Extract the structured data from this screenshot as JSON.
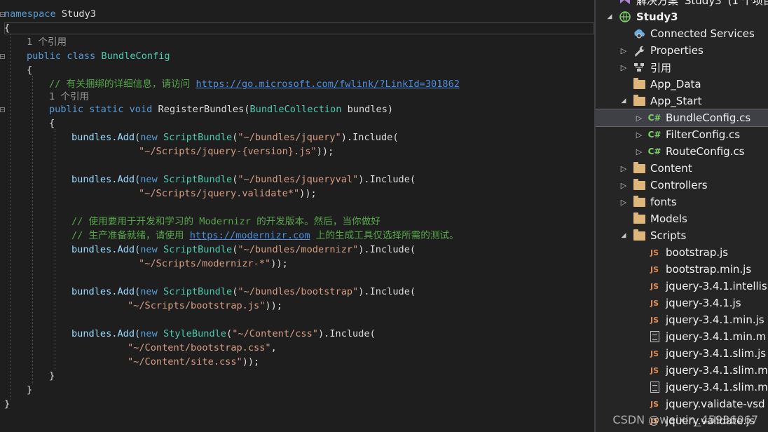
{
  "editor": {
    "lines": [
      {
        "kind": "ns",
        "kw": "namespace",
        "name": " Study3"
      },
      {
        "kind": "plain",
        "text": "{"
      },
      {
        "kind": "lens",
        "text": "1 个引用"
      },
      {
        "kind": "class",
        "kw1": "public",
        "kw2": "class",
        "name": "BundleConfig"
      },
      {
        "kind": "plain",
        "text": "{"
      },
      {
        "kind": "comment_link",
        "comment": "// 有关捆绑的详细信息，请访问 ",
        "link": "https://go.microsoft.com/fwlink/?LinkId=301862"
      },
      {
        "kind": "lens",
        "text": "1 个引用"
      },
      {
        "kind": "method",
        "kw1": "public",
        "kw2": "static",
        "kw3": "void",
        "name": "RegisterBundles",
        "ptype": "BundleCollection",
        "pname": "bundles"
      },
      {
        "kind": "plain",
        "text": "{"
      },
      {
        "kind": "add",
        "pre": "bundles.Add(",
        "kw": "new",
        "type": "ScriptBundle",
        "path": "\"~/bundles/jquery\"",
        "post": ").Include("
      },
      {
        "kind": "str_end",
        "str": "\"~/Scripts/jquery-{version}.js\"",
        "post": "));"
      },
      {
        "kind": "blank"
      },
      {
        "kind": "add",
        "pre": "bundles.Add(",
        "kw": "new",
        "type": "ScriptBundle",
        "path": "\"~/bundles/jqueryval\"",
        "post": ").Include("
      },
      {
        "kind": "str_end",
        "str": "\"~/Scripts/jquery.validate*\"",
        "post": "));"
      },
      {
        "kind": "blank"
      },
      {
        "kind": "comment",
        "text": "// 使用要用于开发和学习的 Modernizr 的开发版本。然后，当你做好"
      },
      {
        "kind": "comment_link2",
        "pre": "// 生产准备就绪，请使用 ",
        "link": "https://modernizr.com",
        "post": " 上的生成工具仅选择所需的测试。"
      },
      {
        "kind": "add",
        "pre": "bundles.Add(",
        "kw": "new",
        "type": "ScriptBundle",
        "path": "\"~/bundles/modernizr\"",
        "post": ").Include("
      },
      {
        "kind": "str_end",
        "str": "\"~/Scripts/modernizr-*\"",
        "post": "));"
      },
      {
        "kind": "blank"
      },
      {
        "kind": "add",
        "pre": "bundles.Add(",
        "kw": "new",
        "type": "ScriptBundle",
        "path": "\"~/bundles/bootstrap\"",
        "post": ").Include("
      },
      {
        "kind": "str_end",
        "str": "\"~/Scripts/bootstrap.js\"",
        "post": "));"
      },
      {
        "kind": "blank"
      },
      {
        "kind": "add",
        "pre": "bundles.Add(",
        "kw": "new",
        "type": "StyleBundle",
        "path": "\"~/Content/css\"",
        "post": ").Include("
      },
      {
        "kind": "str_end",
        "str": "\"~/Content/bootstrap.css\"",
        "post": ","
      },
      {
        "kind": "str_end",
        "str": "\"~/Content/site.css\"",
        "post": "));"
      },
      {
        "kind": "plain",
        "text": "}"
      },
      {
        "kind": "plain",
        "text": "}"
      },
      {
        "kind": "plain",
        "text": "}"
      }
    ]
  },
  "explorer": {
    "items": [
      {
        "label": "解决方案 'Study3' (1 个项目,",
        "icon": "solution-icon",
        "arrow": "",
        "depth": 0
      },
      {
        "label": "Study3",
        "icon": "project-icon",
        "arrow": "expanded",
        "depth": 0,
        "bold": true
      },
      {
        "label": "Connected Services",
        "icon": "connected-services-icon",
        "arrow": "",
        "depth": 1
      },
      {
        "label": "Properties",
        "icon": "wrench-icon",
        "arrow": "collapsed",
        "depth": 1
      },
      {
        "label": "引用",
        "icon": "references-icon",
        "arrow": "collapsed",
        "depth": 1
      },
      {
        "label": "App_Data",
        "icon": "folder-icon",
        "arrow": "",
        "depth": 1
      },
      {
        "label": "App_Start",
        "icon": "folder-icon",
        "arrow": "expanded",
        "depth": 1
      },
      {
        "label": "BundleConfig.cs",
        "icon": "csharp-file-icon",
        "arrow": "collapsed",
        "depth": 2,
        "selected": true
      },
      {
        "label": "FilterConfig.cs",
        "icon": "csharp-file-icon",
        "arrow": "collapsed",
        "depth": 2
      },
      {
        "label": "RouteConfig.cs",
        "icon": "csharp-file-icon",
        "arrow": "collapsed",
        "depth": 2
      },
      {
        "label": "Content",
        "icon": "folder-icon",
        "arrow": "collapsed",
        "depth": 1
      },
      {
        "label": "Controllers",
        "icon": "folder-icon",
        "arrow": "collapsed",
        "depth": 1
      },
      {
        "label": "fonts",
        "icon": "folder-icon",
        "arrow": "collapsed",
        "depth": 1
      },
      {
        "label": "Models",
        "icon": "folder-icon",
        "arrow": "",
        "depth": 1
      },
      {
        "label": "Scripts",
        "icon": "folder-icon",
        "arrow": "expanded",
        "depth": 1
      },
      {
        "label": "bootstrap.js",
        "icon": "js-file-icon",
        "arrow": "",
        "depth": 2
      },
      {
        "label": "bootstrap.min.js",
        "icon": "js-file-icon",
        "arrow": "",
        "depth": 2
      },
      {
        "label": "jquery-3.4.1.intellis",
        "icon": "js-file-icon",
        "arrow": "",
        "depth": 2
      },
      {
        "label": "jquery-3.4.1.js",
        "icon": "js-file-icon",
        "arrow": "",
        "depth": 2
      },
      {
        "label": "jquery-3.4.1.min.js",
        "icon": "js-file-icon",
        "arrow": "",
        "depth": 2
      },
      {
        "label": "jquery-3.4.1.min.m",
        "icon": "doc-file-icon",
        "arrow": "",
        "depth": 2
      },
      {
        "label": "jquery-3.4.1.slim.js",
        "icon": "js-file-icon",
        "arrow": "",
        "depth": 2
      },
      {
        "label": "jquery-3.4.1.slim.m",
        "icon": "js-file-icon",
        "arrow": "",
        "depth": 2
      },
      {
        "label": "jquery-3.4.1.slim.m",
        "icon": "doc-file-icon",
        "arrow": "",
        "depth": 2
      },
      {
        "label": "jquery.validate-vsd",
        "icon": "js-file-icon",
        "arrow": "",
        "depth": 2
      },
      {
        "label": "jquery.validate.js",
        "icon": "js-file-icon",
        "arrow": "",
        "depth": 2
      }
    ]
  },
  "watermark": "CSDN @weixin_45936067"
}
